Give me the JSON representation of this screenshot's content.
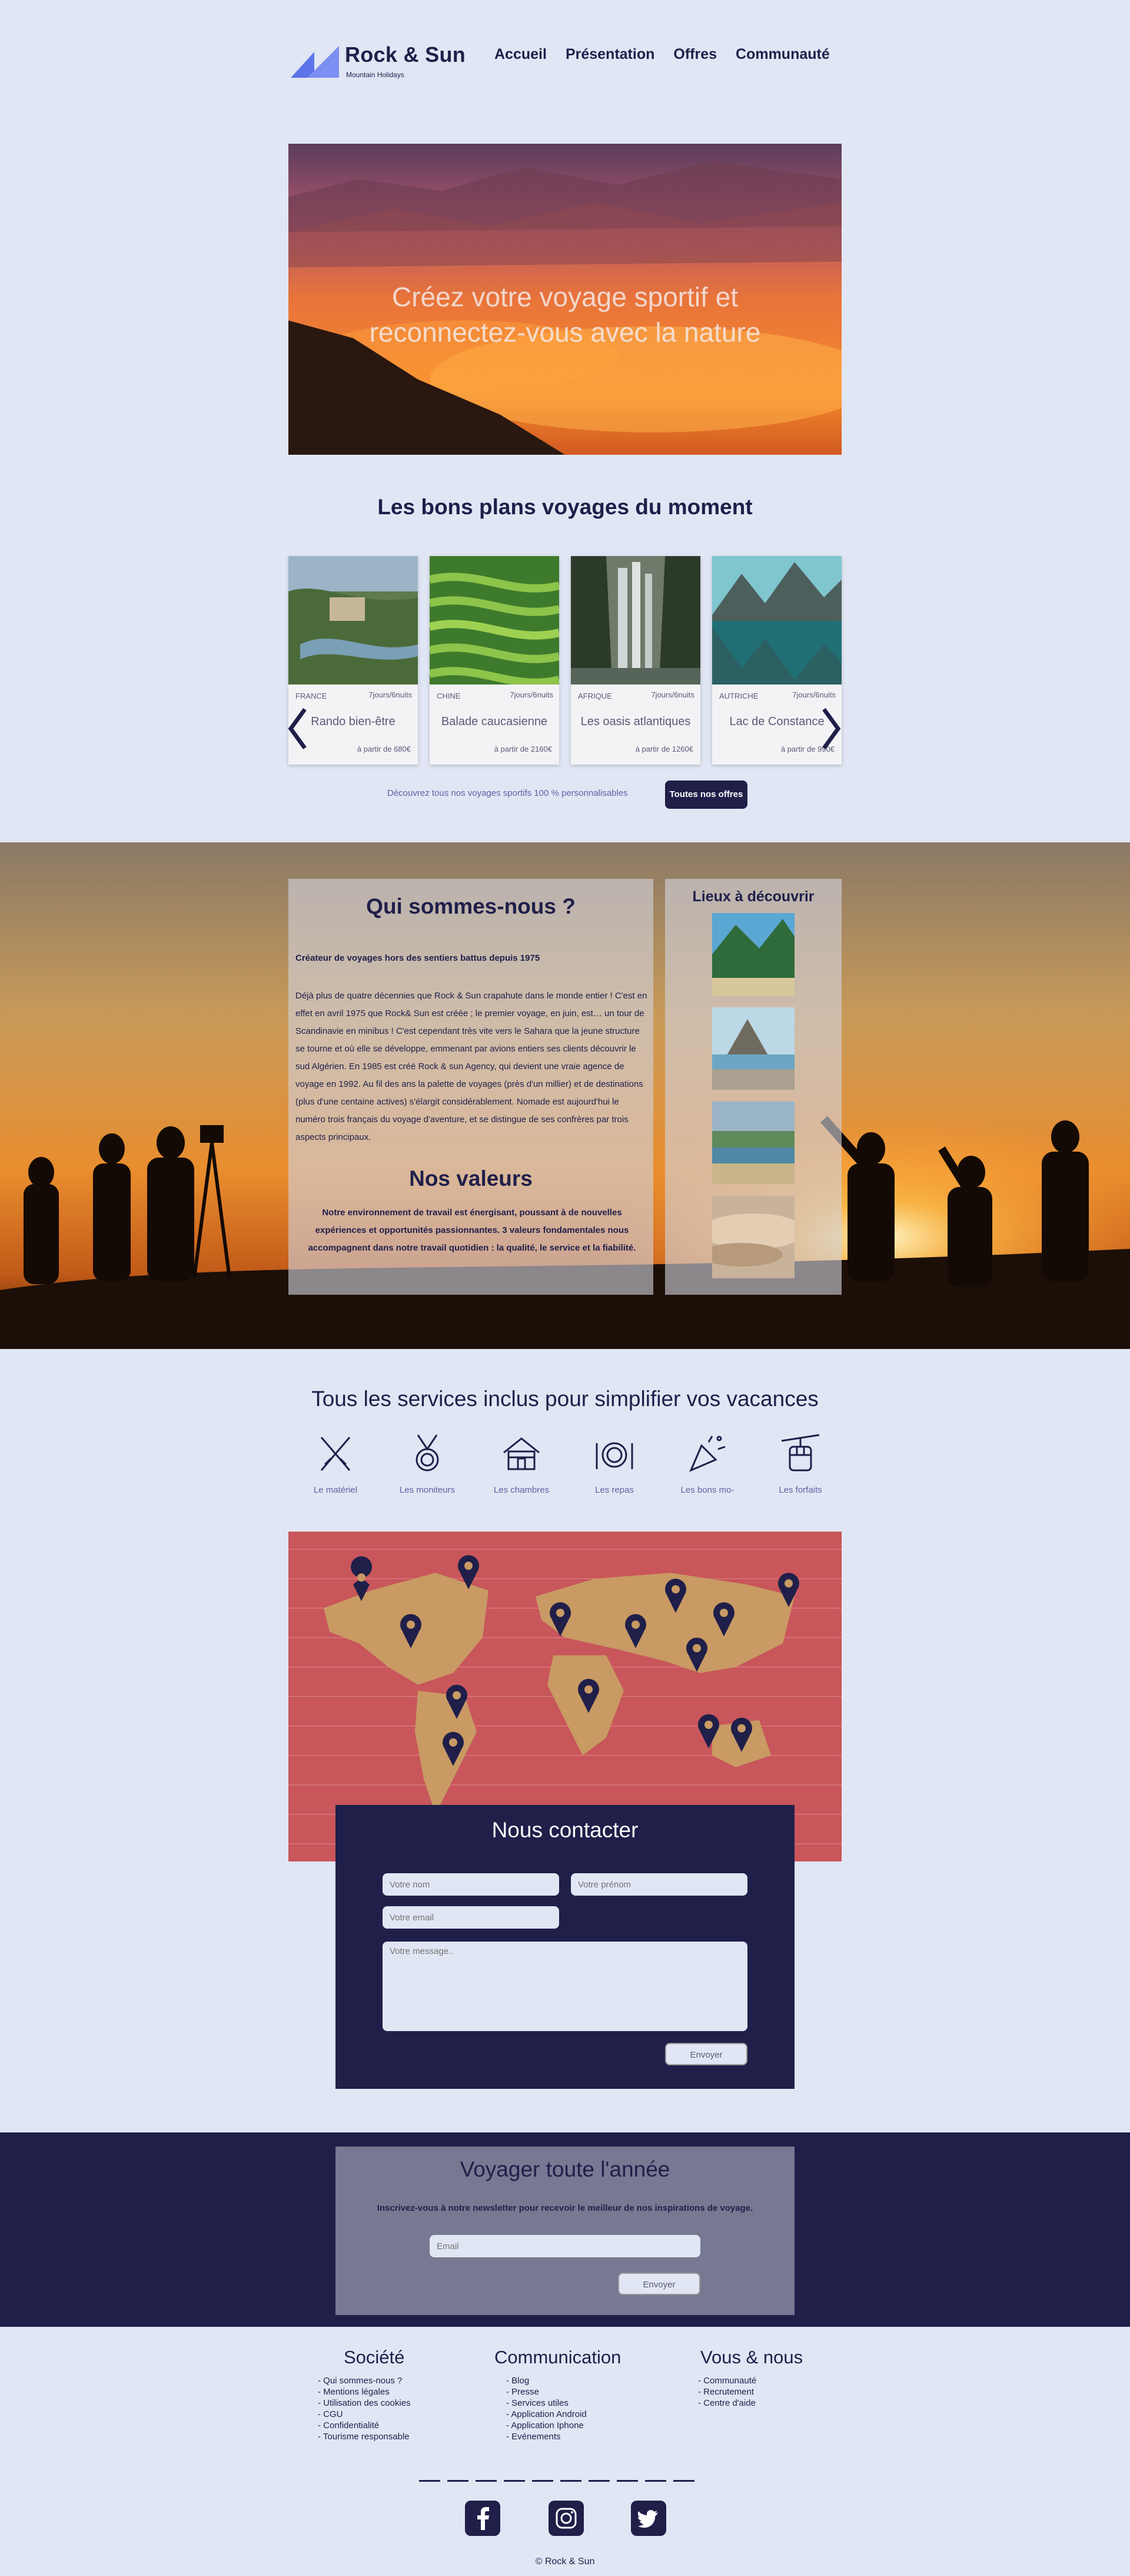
{
  "header": {
    "brand": "Rock & Sun",
    "tagline": "Mountain Holidays",
    "nav": [
      "Accueil",
      "Présentation",
      "Offres",
      "Communauté"
    ]
  },
  "hero": {
    "line1": "Créez votre voyage sportif et",
    "line2": "reconnectez-vous avec la nature"
  },
  "deals": {
    "title": "Les bons plans voyages du moment",
    "cards": [
      {
        "country": "FRANCE",
        "duration": "7jours/6nuits",
        "name": "Rando bien-être",
        "price": "à partir de 680€"
      },
      {
        "country": "CHINE",
        "duration": "7jours/6nuits",
        "name": "Balade caucasienne",
        "price": "à partir de 2160€"
      },
      {
        "country": "AFRIQUE",
        "duration": "7jours/6nuits",
        "name": "Les oasis atlantiques",
        "price": "à partir de 1260€"
      },
      {
        "country": "AUTRICHE",
        "duration": "7jours/6nuits",
        "name": "Lac de Constance",
        "price": "à partir de 990€"
      }
    ],
    "discover_text": "Découvrez tous nos voyages sportifs 100 % personnalisables",
    "button": "Toutes nos offres"
  },
  "about": {
    "title": "Qui sommes-nous ?",
    "subtitle": "Créateur de voyages hors des sentiers battus depuis 1975",
    "body": "Déjà plus de quatre décennies que Rock & Sun crapahute dans le monde entier ! C'est en effet en avril 1975 que Rock& Sun est créée ; le premier voyage, en juin, est… un tour de Scandinavie en minibus ! C'est cependant très vite vers le Sahara que la jeune structure se tourne et où elle se développe, emmenant par avions entiers ses clients découvrir le sud Algérien. En 1985 est créé Rock & sun Agency, qui devient une vraie agence de voyage en 1992. Au fil des ans la palette de voyages (près d'un millier) et de destinations (plus d'une centaine actives) s'élargit considérablement. Nomade est aujourd'hui le numéro trois français du voyage d'aventure, et se distingue de ses confrères par trois aspects principaux.",
    "values_title": "Nos valeurs",
    "values_body": "Notre environnement de travail est énergisant, poussant à de nouvelles expériences et opportunités passionnantes. 3 valeurs fondamentales nous accompagnent dans notre travail quotidien : la qualité, le service et la fiabilité.",
    "places_title": "Lieux à découvrir"
  },
  "services": {
    "title": "Tous les services inclus pour simplifier vos vacances",
    "items": [
      {
        "label": "Le matériel",
        "icon": "ski-icon"
      },
      {
        "label": "Les moniteurs",
        "icon": "medal-icon"
      },
      {
        "label": "Les chambres",
        "icon": "chalet-icon"
      },
      {
        "label": "Les repas",
        "icon": "plate-icon"
      },
      {
        "label": "Les bons mo-",
        "icon": "party-popper-icon"
      },
      {
        "label": "Les forfaits",
        "icon": "cable-car-icon"
      }
    ]
  },
  "contact": {
    "title": "Nous contacter",
    "name_placeholder": "Votre nom",
    "firstname_placeholder": "Votre prénom",
    "email_placeholder": "Votre email",
    "message_placeholder": "Votre message..",
    "send": "Envoyer"
  },
  "newsletter": {
    "title": "Voyager toute l'année",
    "subtitle": "Inscrivez-vous à notre newsletter pour recevoir le meilleur de nos inspirations de voyage.",
    "email_placeholder": "Email",
    "send": "Envoyer"
  },
  "footer": {
    "columns": [
      {
        "title": "Société",
        "links": [
          "- Qui sommes-nous ?",
          "- Mentions légales",
          "- Utilisation des cookies",
          "- CGU",
          "- Confidentialité",
          "- Tourisme responsable"
        ]
      },
      {
        "title": "Communication",
        "links": [
          "- Blog",
          "- Presse",
          "- Services utiles",
          "- Application Android",
          "- Application Iphone",
          "- Evénements"
        ]
      },
      {
        "title": "Vous & nous",
        "links": [
          "- Communauté",
          "- Recrutement",
          "- Centre d'aide"
        ]
      }
    ],
    "copyright": "© Rock & Sun"
  },
  "colors": {
    "navy": "#1f1f4a",
    "background": "#e1e6f4",
    "accent": "#5c63a3"
  }
}
